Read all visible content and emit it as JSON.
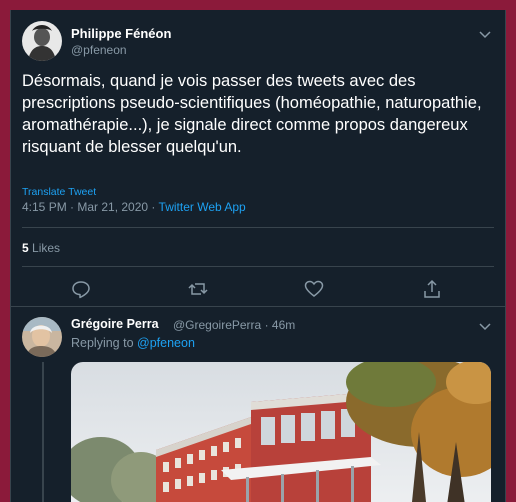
{
  "tweet": {
    "author_name": "Philippe Fénéon",
    "author_handle": "@pfeneon",
    "text": "Désormais, quand je vois passer des tweets avec des prescriptions pseudo-scientifiques (homéopathie, naturopathie, aromathérapie...), je signale direct comme propos dangereux risquant de blesser quelqu'un.",
    "translate_label": "Translate Tweet",
    "timestamp": "4:15 PM · Mar 21, 2020",
    "separator": " · ",
    "source": "Twitter Web App",
    "likes_count": "5",
    "likes_label": "Likes"
  },
  "icons": {
    "more": "chevron-down-icon",
    "reply": "reply-icon",
    "retweet": "retweet-icon",
    "like": "heart-icon",
    "share": "share-icon"
  },
  "reply": {
    "author_name": "Grégoire Perra",
    "author_handle": "@GregoirePerra",
    "dot": "·",
    "time_ago": "46m",
    "replying_to_label": "Replying to",
    "replying_to_mention": "@pfeneon"
  },
  "colors": {
    "background": "#15202b",
    "border": "#38444d",
    "accent": "#1da1f2",
    "text_secondary": "#8899a6",
    "outer_frame": "#8b1a3a"
  }
}
